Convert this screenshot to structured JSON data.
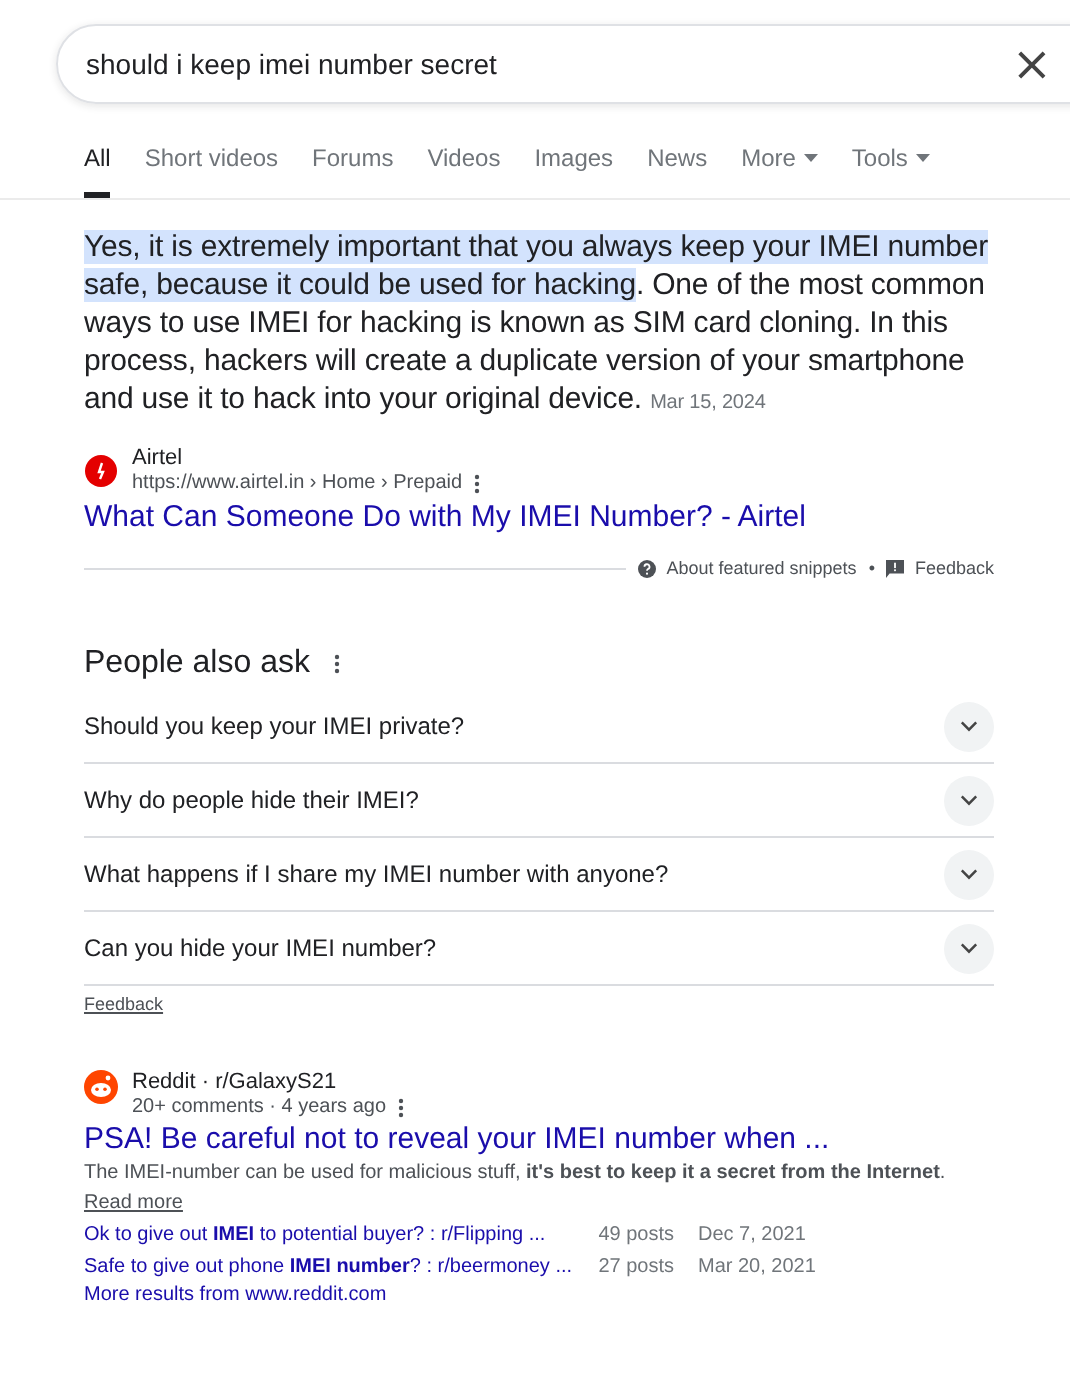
{
  "search": {
    "value": "should i keep imei number secret",
    "clear": "×"
  },
  "tabs": [
    {
      "label": "All",
      "selected": true,
      "kind": "plain"
    },
    {
      "label": "Short videos",
      "selected": false,
      "kind": "plain"
    },
    {
      "label": "Forums",
      "selected": false,
      "kind": "plain"
    },
    {
      "label": "Videos",
      "selected": false,
      "kind": "plain"
    },
    {
      "label": "Images",
      "selected": false,
      "kind": "plain"
    },
    {
      "label": "News",
      "selected": false,
      "kind": "plain"
    },
    {
      "label": "More",
      "selected": false,
      "kind": "menu"
    },
    {
      "label": "Tools",
      "selected": false,
      "kind": "menu"
    }
  ],
  "featured_snippet": {
    "highlight": "Yes, it is extremely important that you always keep your IMEI number safe, because it could be used for hacking",
    "text": ". One of the most common ways to use IMEI for hacking is known as SIM card cloning. In this process, hackers will create a duplicate version of your smartphone and use it to hack into your original device.",
    "date": "Mar 15, 2024",
    "source": {
      "name": "Airtel",
      "url": "https://www.airtel.in › Home › Prepaid"
    },
    "title": "What Can Someone Do with My IMEI Number? - Airtel",
    "about": "About featured snippets",
    "separator": "•",
    "feedback": "Feedback"
  },
  "people_also_ask": {
    "title": "People also ask",
    "questions": [
      {
        "text": "Should you keep your IMEI private?",
        "expanded": false
      },
      {
        "text": "Why do people hide their IMEI?",
        "expanded": false
      },
      {
        "text": "What happens if I share my IMEI number with anyone?",
        "expanded": false
      },
      {
        "text": "Can you hide your IMEI number?",
        "expanded": false
      }
    ],
    "feedback": "Feedback"
  },
  "result": {
    "source": "Reddit · r/GalaxyS21",
    "meta": "20+ comments · 4 years ago",
    "title": "PSA! Be careful not to reveal your IMEI number when ...",
    "snippet": "The IMEI-number can be used for malicious stuff, **it's best to keep it a secret from the Internet**.",
    "read_more": "Read more",
    "sitelinks": [
      {
        "title": "Ok to give out **IMEI** to potential buyer? : r/Flipping ...",
        "posts": "49 posts",
        "date": "Dec 7, 2021"
      },
      {
        "title": "Safe to give out phone **IMEI number**? : r/beermoney ...",
        "posts": "27 posts",
        "date": "Mar 20, 2021"
      }
    ],
    "more": "More results from www.reddit.com"
  }
}
